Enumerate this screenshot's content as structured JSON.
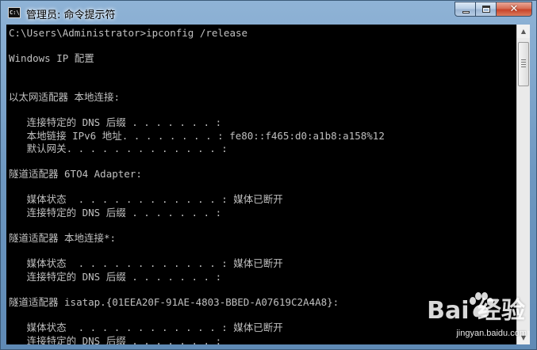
{
  "window": {
    "title": "管理员: 命令提示符",
    "icon_label": "C:\\",
    "buttons": {
      "minimize": "minimize-icon",
      "maximize": "maximize-icon",
      "close": "✕"
    }
  },
  "console": {
    "lines": [
      "C:\\Users\\Administrator>ipconfig /release",
      "",
      "Windows IP 配置",
      "",
      "",
      "以太网适配器 本地连接:",
      "",
      "   连接特定的 DNS 后缀 . . . . . . . :",
      "   本地链接 IPv6 地址. . . . . . . . : fe80::f465:d0:a1b8:a158%12",
      "   默认网关. . . . . . . . . . . . . :",
      "",
      "隧道适配器 6TO4 Adapter:",
      "",
      "   媒体状态  . . . . . . . . . . . . : 媒体已断开",
      "   连接特定的 DNS 后缀 . . . . . . . :",
      "",
      "隧道适配器 本地连接*:",
      "",
      "   媒体状态  . . . . . . . . . . . . : 媒体已断开",
      "   连接特定的 DNS 后缀 . . . . . . . :",
      "",
      "隧道适配器 isatap.{01EEA20F-91AE-4803-BBED-A07619C2A4A8}:",
      "",
      "   媒体状态  . . . . . . . . . . . . : 媒体已断开",
      "   连接特定的 DNS 后缀 . . . . . . . :"
    ]
  },
  "watermark": {
    "brand": "Bai 经验",
    "url": "jingyan.baidu.com"
  },
  "colors": {
    "console_bg": "#000000",
    "console_text": "#c0c0c0",
    "titlebar": "#7ea4c8",
    "close_button": "#c8442a"
  }
}
